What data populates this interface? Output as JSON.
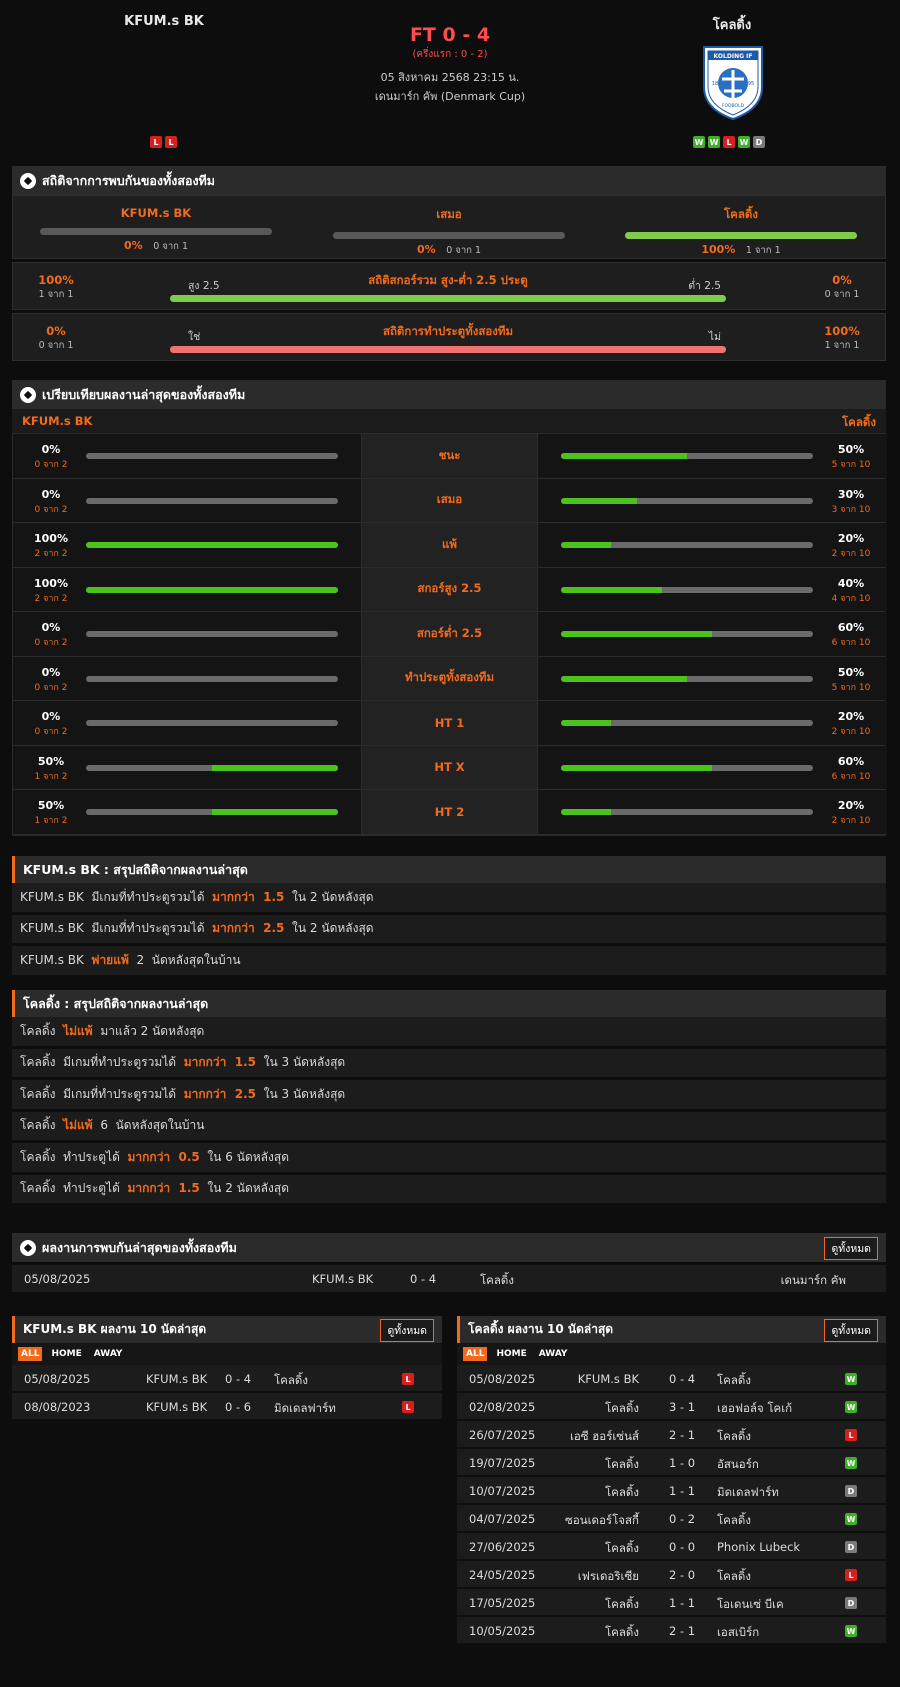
{
  "match": {
    "home_team": "KFUM.s BK",
    "away_team": "โคลดิ้ง",
    "score": "FT 0 - 4",
    "half_time": "(ครึ่งแรก : 0 - 2)",
    "datetime": "05 สิงหาคม 2568 23:15 น.",
    "competition": "เดนมาร์ก คัพ (Denmark Cup)",
    "home_form": [
      "L",
      "L"
    ],
    "away_form": [
      "W",
      "W",
      "L",
      "W",
      "D"
    ],
    "away_logo_text": "KOLDING IF",
    "away_logo_subtext": "FODBOLD",
    "away_logo_year_left": "18",
    "away_logo_year_right": "95"
  },
  "h2h_stats": {
    "title": "สถิติจากการพบกันของทั้งสองทีม",
    "home": {
      "label": "KFUM.s BK",
      "pct": "0%",
      "count": "0 จาก 1",
      "fill": 0
    },
    "draw": {
      "label": "เสมอ",
      "pct": "0%",
      "count": "0 จาก 1",
      "fill": 0
    },
    "away": {
      "label": "โคลดิ้ง",
      "pct": "100%",
      "count": "1 จาก 1",
      "fill": 1
    },
    "over_under": {
      "title": "สถิติสกอร์รวม สูง-ต่ำ 2.5 ประตู",
      "left_label": "สูง 2.5",
      "right_label": "ต่ำ 2.5",
      "left_pct": "100%",
      "left_count": "1 จาก 1",
      "right_pct": "0%",
      "right_count": "0 จาก 1",
      "fill": 1
    },
    "btts": {
      "title": "สถิติการทำประตูทั้งสองทีม",
      "left_label": "ใช่",
      "right_label": "ไม่",
      "left_pct": "0%",
      "left_count": "0 จาก 1",
      "right_pct": "100%",
      "right_count": "1 จาก 1",
      "fill": 1
    }
  },
  "compare": {
    "title": "เปรียบเทียบผลงานล่าสุดของทั้งสองทีม",
    "home_label": "KFUM.s BK",
    "away_label": "โคลดิ้ง",
    "rows": [
      {
        "label": "ชนะ",
        "home_pct": "0%",
        "home_count": "0 จาก 2",
        "home_fill": 0,
        "away_pct": "50%",
        "away_count": "5 จาก 10",
        "away_fill": 0.5
      },
      {
        "label": "เสมอ",
        "home_pct": "0%",
        "home_count": "0 จาก 2",
        "home_fill": 0,
        "away_pct": "30%",
        "away_count": "3 จาก 10",
        "away_fill": 0.3
      },
      {
        "label": "แพ้",
        "home_pct": "100%",
        "home_count": "2 จาก 2",
        "home_fill": 1,
        "away_pct": "20%",
        "away_count": "2 จาก 10",
        "away_fill": 0.2
      },
      {
        "label": "สกอร์สูง 2.5",
        "home_pct": "100%",
        "home_count": "2 จาก 2",
        "home_fill": 1,
        "away_pct": "40%",
        "away_count": "4 จาก 10",
        "away_fill": 0.4
      },
      {
        "label": "สกอร์ต่ำ 2.5",
        "home_pct": "0%",
        "home_count": "0 จาก 2",
        "home_fill": 0,
        "away_pct": "60%",
        "away_count": "6 จาก 10",
        "away_fill": 0.6
      },
      {
        "label": "ทำประตูทั้งสองทีม",
        "home_pct": "0%",
        "home_count": "0 จาก 2",
        "home_fill": 0,
        "away_pct": "50%",
        "away_count": "5 จาก 10",
        "away_fill": 0.5
      },
      {
        "label": "HT 1",
        "home_pct": "0%",
        "home_count": "0 จาก 2",
        "home_fill": 0,
        "away_pct": "20%",
        "away_count": "2 จาก 10",
        "away_fill": 0.2
      },
      {
        "label": "HT X",
        "home_pct": "50%",
        "home_count": "1 จาก 2",
        "home_fill": 0.5,
        "away_pct": "60%",
        "away_count": "6 จาก 10",
        "away_fill": 0.6
      },
      {
        "label": "HT 2",
        "home_pct": "50%",
        "home_count": "1 จาก 2",
        "home_fill": 0.5,
        "away_pct": "20%",
        "away_count": "2 จาก 10",
        "away_fill": 0.2
      }
    ]
  },
  "home_summary": {
    "title": "KFUM.s BK : สรุปสถิติจากผลงานล่าสุด",
    "rows": [
      {
        "pre": "KFUM.s BK  มีเกมที่ทำประตูรวมได้  ",
        "hl": "มากกว่า  1.5",
        "post": "  ใน 2 นัดหลังสุด"
      },
      {
        "pre": "KFUM.s BK  มีเกมที่ทำประตูรวมได้  ",
        "hl": "มากกว่า  2.5",
        "post": "  ใน 2 นัดหลังสุด"
      },
      {
        "pre": "KFUM.s BK  ",
        "hl": "พ่ายแพ้",
        "post": "  2  นัดหลังสุดในบ้าน"
      }
    ]
  },
  "away_summary": {
    "title": "โคลดิ้ง : สรุปสถิติจากผลงานล่าสุด",
    "rows": [
      {
        "pre": "โคลดิ้ง  ",
        "hl": "ไม่แพ้",
        "post": "  มาแล้ว 2 นัดหลังสุด"
      },
      {
        "pre": "โคลดิ้ง  มีเกมที่ทำประตูรวมได้  ",
        "hl": "มากกว่า  1.5",
        "post": "  ใน 3 นัดหลังสุด"
      },
      {
        "pre": "โคลดิ้ง  มีเกมที่ทำประตูรวมได้  ",
        "hl": "มากกว่า  2.5",
        "post": "  ใน 3 นัดหลังสุด"
      },
      {
        "pre": "โคลดิ้ง  ",
        "hl": "ไม่แพ้",
        "post": "  6  นัดหลังสุดในบ้าน"
      },
      {
        "pre": "โคลดิ้ง  ทำประตูได้  ",
        "hl": "มากกว่า  0.5",
        "post": "  ใน 6 นัดหลังสุด"
      },
      {
        "pre": "โคลดิ้ง  ทำประตูได้  ",
        "hl": "มากกว่า  1.5",
        "post": "  ใน 2 นัดหลังสุด"
      }
    ]
  },
  "last_h2h": {
    "title": "ผลงานการพบกันล่าสุดของทั้งสองทีม",
    "view_all": "ดูทั้งหมด",
    "rows": [
      {
        "date": "05/08/2025",
        "home": "KFUM.s BK",
        "score": "0 - 4",
        "away": "โคลดิ้ง",
        "comp": "เดนมาร์ก คัพ"
      }
    ]
  },
  "home_last10": {
    "title": "KFUM.s BK ผลงาน 10 นัดล่าสุด",
    "view_all": "ดูทั้งหมด",
    "tabs": [
      "ALL",
      "HOME",
      "AWAY"
    ],
    "rows": [
      {
        "date": "05/08/2025",
        "home": "KFUM.s BK",
        "score": "0 - 4",
        "away": "โคลดิ้ง",
        "result": "L"
      },
      {
        "date": "08/08/2023",
        "home": "KFUM.s BK",
        "score": "0 - 6",
        "away": "มิดเดลฟาร์ท",
        "result": "L"
      }
    ]
  },
  "away_last10": {
    "title": "โคลดิ้ง ผลงาน 10 นัดล่าสุด",
    "view_all": "ดูทั้งหมด",
    "tabs": [
      "ALL",
      "HOME",
      "AWAY"
    ],
    "rows": [
      {
        "date": "05/08/2025",
        "home": "KFUM.s BK",
        "score": "0 - 4",
        "away": "โคลดิ้ง",
        "result": "W"
      },
      {
        "date": "02/08/2025",
        "home": "โคลดิ้ง",
        "score": "3 - 1",
        "away": "เฮอฟอล์จ โคเก้",
        "result": "W"
      },
      {
        "date": "26/07/2025",
        "home": "เอซี ฮอร์เซ่นส์",
        "score": "2 - 1",
        "away": "โคลดิ้ง",
        "result": "L"
      },
      {
        "date": "19/07/2025",
        "home": "โคลดิ้ง",
        "score": "1 - 0",
        "away": "อัสนอร์ก",
        "result": "W"
      },
      {
        "date": "10/07/2025",
        "home": "โคลดิ้ง",
        "score": "1 - 1",
        "away": "มิดเดลฟาร์ท",
        "result": "D"
      },
      {
        "date": "04/07/2025",
        "home": "ซอนเดอร์โจสกี้",
        "score": "0 - 2",
        "away": "โคลดิ้ง",
        "result": "W"
      },
      {
        "date": "27/06/2025",
        "home": "โคลดิ้ง",
        "score": "0 - 0",
        "away": "Phonix Lubeck",
        "result": "D"
      },
      {
        "date": "24/05/2025",
        "home": "เฟรเดอริเซีย",
        "score": "2 - 0",
        "away": "โคลดิ้ง",
        "result": "L"
      },
      {
        "date": "17/05/2025",
        "home": "โคลดิ้ง",
        "score": "1 - 1",
        "away": "โอเดนเซ่ บีเค",
        "result": "D"
      },
      {
        "date": "10/05/2025",
        "home": "โคลดิ้ง",
        "score": "2 - 1",
        "away": "เอสเบิร์ก",
        "result": "W"
      }
    ]
  },
  "colors": {
    "accent": "#f26b1d",
    "win": "#3fae29",
    "loss": "#d61f1f",
    "draw": "#7a7a7a",
    "bar_green": "#4cc21c",
    "bar_red": "#f27272"
  }
}
